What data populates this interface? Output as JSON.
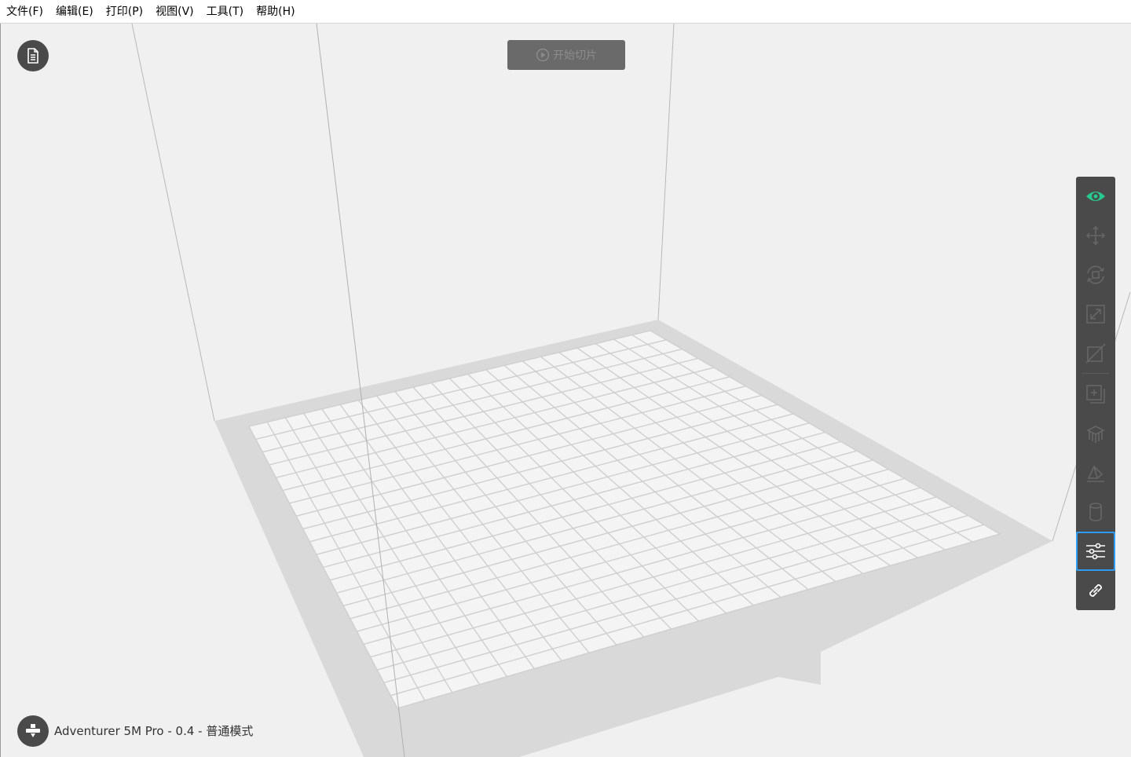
{
  "menubar": {
    "items": [
      "文件(F)",
      "编辑(E)",
      "打印(P)",
      "视图(V)",
      "工具(T)",
      "帮助(H)"
    ]
  },
  "viewport": {
    "slice_button_label": "开始切片",
    "printer_label": "Adventurer 5M Pro - 0.4 - 普通模式",
    "file_info_icon": "document-icon",
    "printer_icon": "nozzle-icon"
  },
  "toolbar": {
    "tools": [
      {
        "icon": "eye-icon",
        "state": "active-green"
      },
      {
        "icon": "move-icon",
        "state": "disabled"
      },
      {
        "icon": "rotate-icon",
        "state": "disabled"
      },
      {
        "icon": "scale-icon",
        "state": "disabled"
      },
      {
        "icon": "cut-icon",
        "state": "disabled"
      },
      {
        "icon": "add-copy-icon",
        "state": "disabled"
      },
      {
        "icon": "support-icon",
        "state": "disabled"
      },
      {
        "icon": "lay-flat-icon",
        "state": "disabled"
      },
      {
        "icon": "cylinder-icon",
        "state": "disabled"
      },
      {
        "icon": "settings-sliders-icon",
        "state": "selected"
      },
      {
        "icon": "link-icon",
        "state": "normal"
      }
    ]
  },
  "colors": {
    "accent_green": "#26c98e",
    "selected_border": "#2f9bf2",
    "toolbar_bg": "#4a4a4a",
    "viewport_bg": "#f0f0f0",
    "plate_border": "#d9d9d9"
  }
}
